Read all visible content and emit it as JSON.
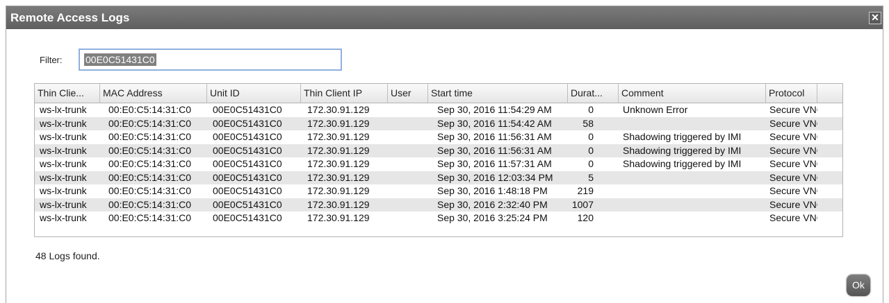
{
  "dialog": {
    "title": "Remote Access Logs",
    "close_glyph": "✕"
  },
  "filter": {
    "label": "Filter:",
    "value": "00E0C51431C0"
  },
  "table": {
    "columns": [
      "Thin Clie...",
      "MAC Address",
      "Unit ID",
      "Thin Client IP",
      "User",
      "Start time",
      "Durat...",
      "Comment",
      "Protocol"
    ],
    "rows": [
      [
        "ws-lx-trunk",
        "00:E0:C5:14:31:C0",
        "00E0C51431C0",
        "172.30.91.129",
        "",
        "Sep 30, 2016 11:54:29 AM",
        "0",
        "Unknown Error",
        "Secure VNC"
      ],
      [
        "ws-lx-trunk",
        "00:E0:C5:14:31:C0",
        "00E0C51431C0",
        "172.30.91.129",
        "",
        "Sep 30, 2016 11:54:42 AM",
        "58",
        "",
        "Secure VNC"
      ],
      [
        "ws-lx-trunk",
        "00:E0:C5:14:31:C0",
        "00E0C51431C0",
        "172.30.91.129",
        "",
        "Sep 30, 2016 11:56:31 AM",
        "0",
        "Shadowing triggered by IMI",
        "Secure VNC"
      ],
      [
        "ws-lx-trunk",
        "00:E0:C5:14:31:C0",
        "00E0C51431C0",
        "172.30.91.129",
        "",
        "Sep 30, 2016 11:56:31 AM",
        "0",
        "Shadowing triggered by IMI",
        "Secure VNC"
      ],
      [
        "ws-lx-trunk",
        "00:E0:C5:14:31:C0",
        "00E0C51431C0",
        "172.30.91.129",
        "",
        "Sep 30, 2016 11:57:31 AM",
        "0",
        "Shadowing triggered by IMI",
        "Secure VNC"
      ],
      [
        "ws-lx-trunk",
        "00:E0:C5:14:31:C0",
        "00E0C51431C0",
        "172.30.91.129",
        "",
        "Sep 30, 2016 12:03:34 PM",
        "5",
        "",
        "Secure VNC"
      ],
      [
        "ws-lx-trunk",
        "00:E0:C5:14:31:C0",
        "00E0C51431C0",
        "172.30.91.129",
        "",
        "Sep 30, 2016 1:48:18 PM",
        "219",
        "",
        "Secure VNC"
      ],
      [
        "ws-lx-trunk",
        "00:E0:C5:14:31:C0",
        "00E0C51431C0",
        "172.30.91.129",
        "",
        "Sep 30, 2016 2:32:40 PM",
        "1007",
        "",
        "Secure VNC"
      ],
      [
        "ws-lx-trunk",
        "00:E0:C5:14:31:C0",
        "00E0C51431C0",
        "172.30.91.129",
        "",
        "Sep 30, 2016 3:25:24 PM",
        "120",
        "",
        "Secure VNC"
      ]
    ]
  },
  "scrollbar": {
    "up_icon": "arrow-up-icon",
    "down_icon": "arrow-down-icon",
    "up_glyph": "▲",
    "down_glyph": "▼"
  },
  "status": {
    "text": "48 Logs found."
  },
  "ok_button": {
    "label": "Ok"
  }
}
